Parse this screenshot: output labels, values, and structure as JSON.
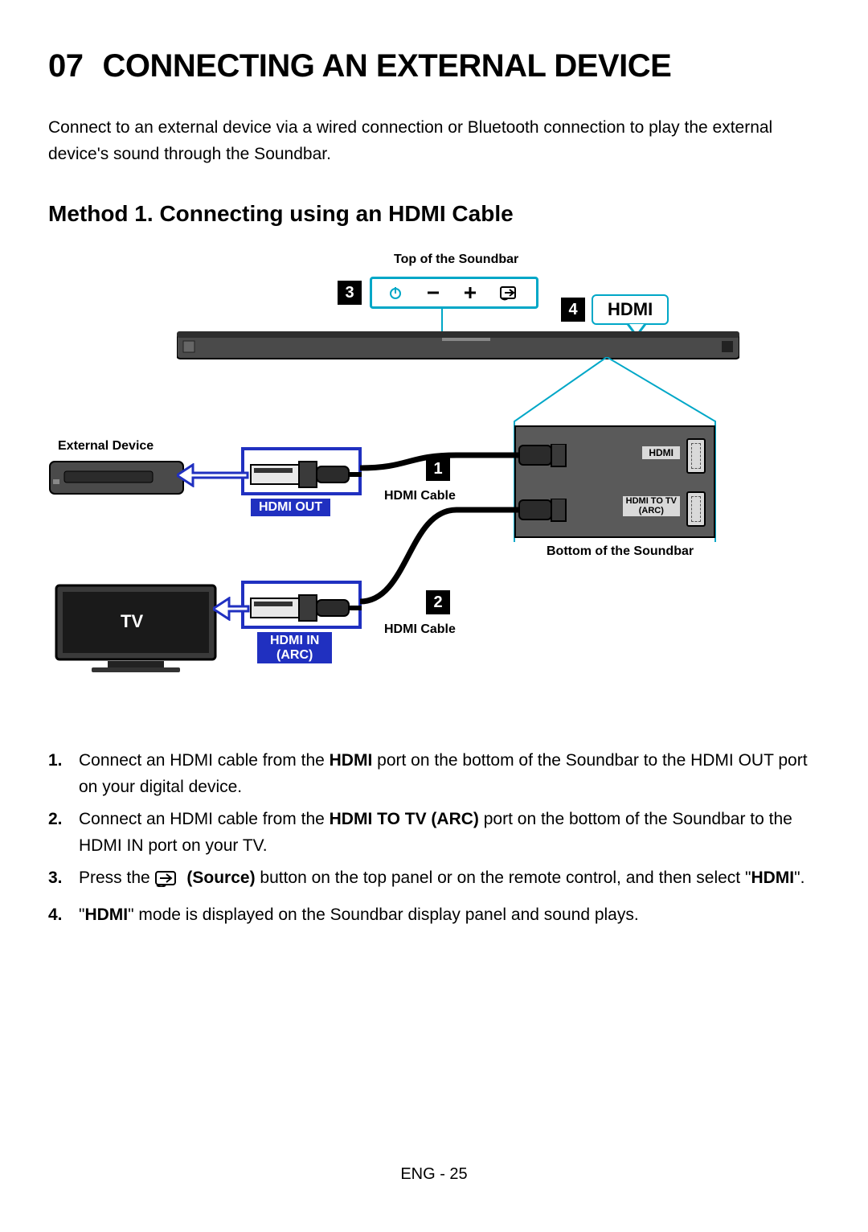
{
  "chapter": {
    "num": "07",
    "title": "CONNECTING AN EXTERNAL DEVICE"
  },
  "intro": "Connect to an external device via a wired connection or Bluetooth connection to play the external device's sound through the Soundbar.",
  "method_title": "Method 1. Connecting using an HDMI Cable",
  "diagram": {
    "top_label": "Top of the Soundbar",
    "hdmi_bubble": "HDMI",
    "external_device": "External Device",
    "hdmi_out": "HDMI OUT",
    "hdmi_cable": "HDMI Cable",
    "hdmi_in1": "HDMI IN",
    "hdmi_in2": "(ARC)",
    "tv": "TV",
    "port_hdmi": "HDMI",
    "port_hdmi_to_tv1": "HDMI TO TV",
    "port_hdmi_to_tv2": "(ARC)",
    "bottom_label": "Bottom of the Soundbar"
  },
  "steps": {
    "s1a": "Connect an HDMI cable from the ",
    "s1b": "HDMI",
    "s1c": " port on the bottom of the Soundbar to the HDMI OUT port on your digital device.",
    "s2a": "Connect an HDMI cable from the ",
    "s2b": "HDMI TO TV (ARC)",
    "s2c": " port on the bottom of the Soundbar to the HDMI IN port on your TV.",
    "s3a": "Press the ",
    "s3b": " (Source)",
    "s3c": " button on the top panel or on the remote control, and then select \"",
    "s3d": "HDMI",
    "s3e": "\".",
    "s4a": "\"",
    "s4b": "HDMI",
    "s4c": "\" mode is displayed on the Soundbar display panel and sound plays."
  },
  "footer": "ENG - 25"
}
